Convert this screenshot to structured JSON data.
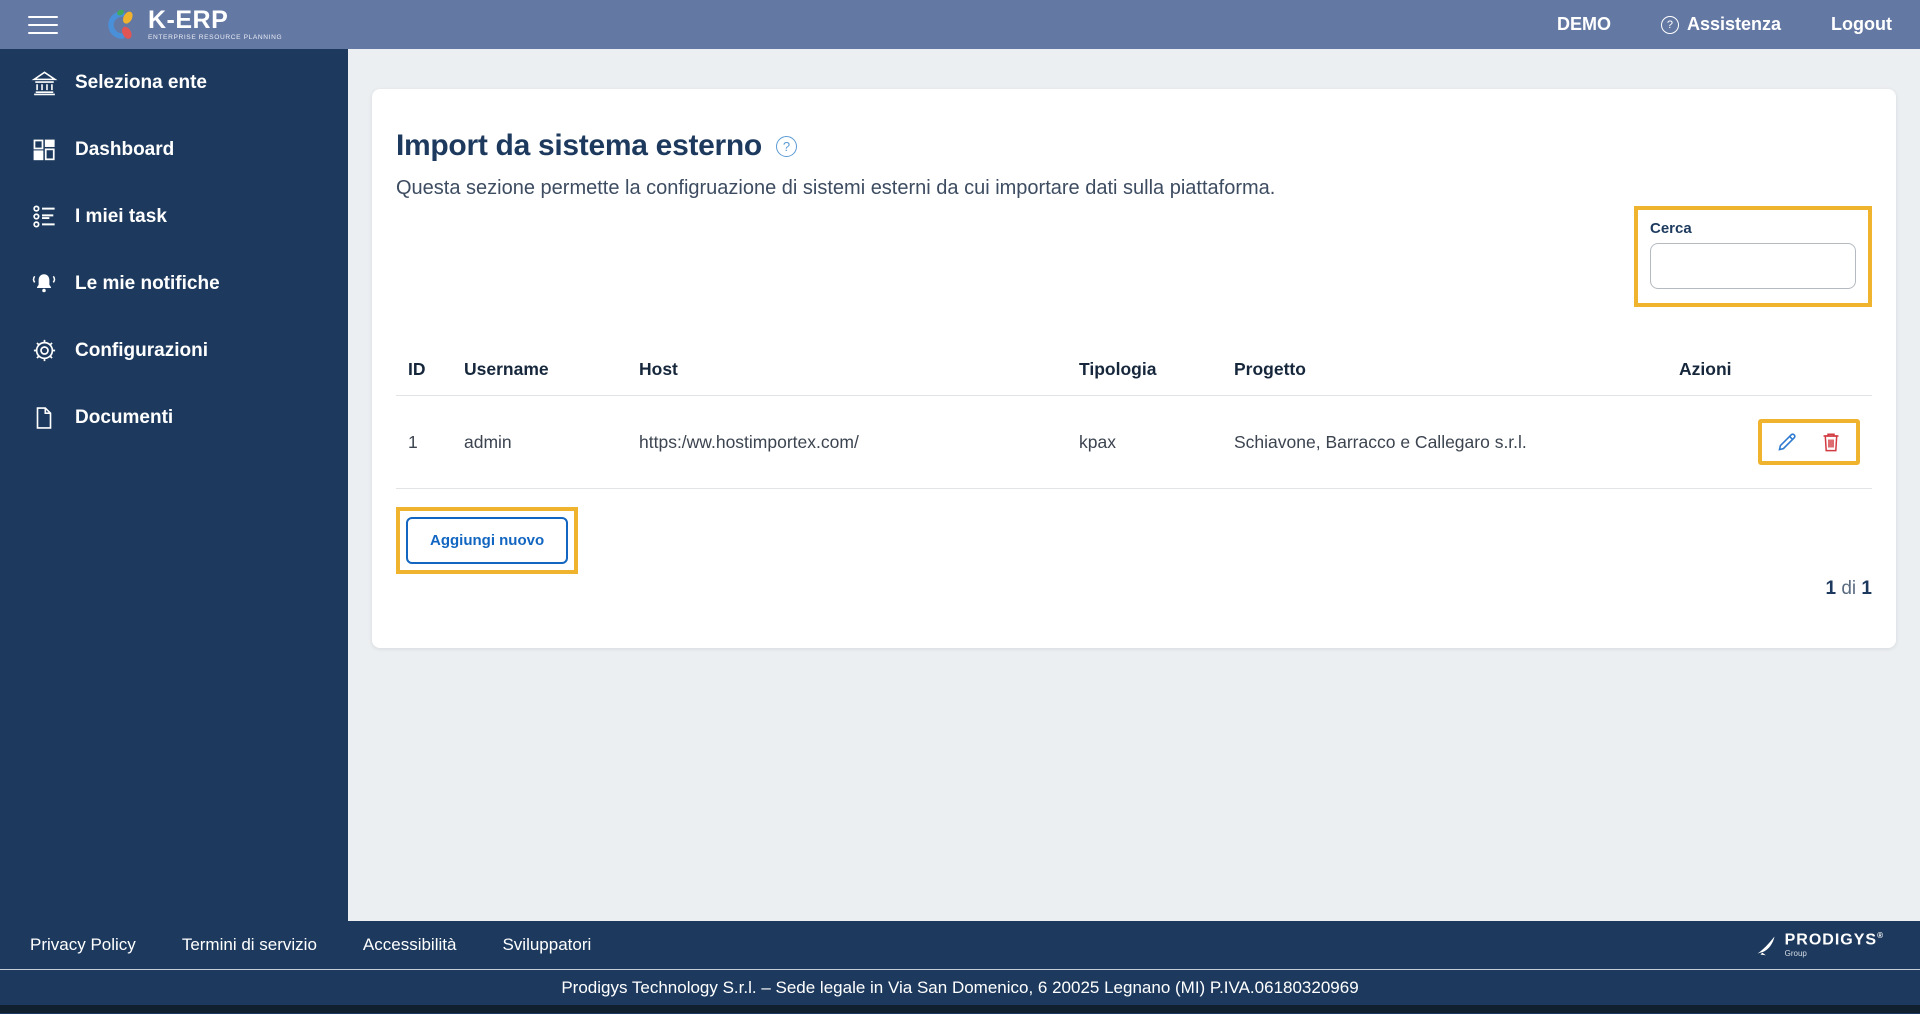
{
  "topbar": {
    "brand_name": "K-ERP",
    "brand_tagline": "ENTERPRISE RESOURCE PLANNING",
    "user_label": "DEMO",
    "assistance_label": "Assistenza",
    "logout_label": "Logout"
  },
  "sidebar": {
    "items": [
      {
        "label": "Seleziona ente",
        "icon": "bank-icon"
      },
      {
        "label": "Dashboard",
        "icon": "dashboard-icon"
      },
      {
        "label": "I miei task",
        "icon": "tasks-icon"
      },
      {
        "label": "Le mie notifiche",
        "icon": "bell-icon"
      },
      {
        "label": "Configurazioni",
        "icon": "gear-icon"
      },
      {
        "label": "Documenti",
        "icon": "document-icon"
      }
    ]
  },
  "main": {
    "title": "Import da sistema esterno",
    "help_glyph": "?",
    "subtitle": "Questa sezione permette la configruazione di sistemi esterni da cui importare dati sulla piattaforma.",
    "search": {
      "label": "Cerca",
      "value": ""
    },
    "table": {
      "headers": [
        "ID",
        "Username",
        "Host",
        "Tipologia",
        "Progetto",
        "Azioni"
      ],
      "rows": [
        {
          "id": "1",
          "username": "admin",
          "host": "https:/ww.hostimportex.com/",
          "tipologia": "kpax",
          "progetto": "Schiavone, Barracco e Callegaro s.r.l."
        }
      ]
    },
    "add_button_label": "Aggiungi nuovo",
    "pagination": {
      "current": "1",
      "separator": "di",
      "total": "1"
    }
  },
  "footer": {
    "links": [
      "Privacy Policy",
      "Termini di servizio",
      "Accessibilità",
      "Sviluppatori"
    ],
    "brand_name": "PRODIGYS",
    "brand_registered": "®",
    "brand_sub": "Group",
    "copyright": "Prodigys Technology S.r.l. – Sede legale in Via San Domenico, 6 20025 Legnano (MI) P.IVA.06180320969"
  },
  "colors": {
    "topbar": "#6478a4",
    "sidebar_navy": "#1d3a5e",
    "accent_yellow": "#f0b32e",
    "action_blue": "#1266c1",
    "pencil_blue": "#2e7ad1",
    "danger_red": "#d23b41",
    "page_bg": "#eceff1"
  }
}
